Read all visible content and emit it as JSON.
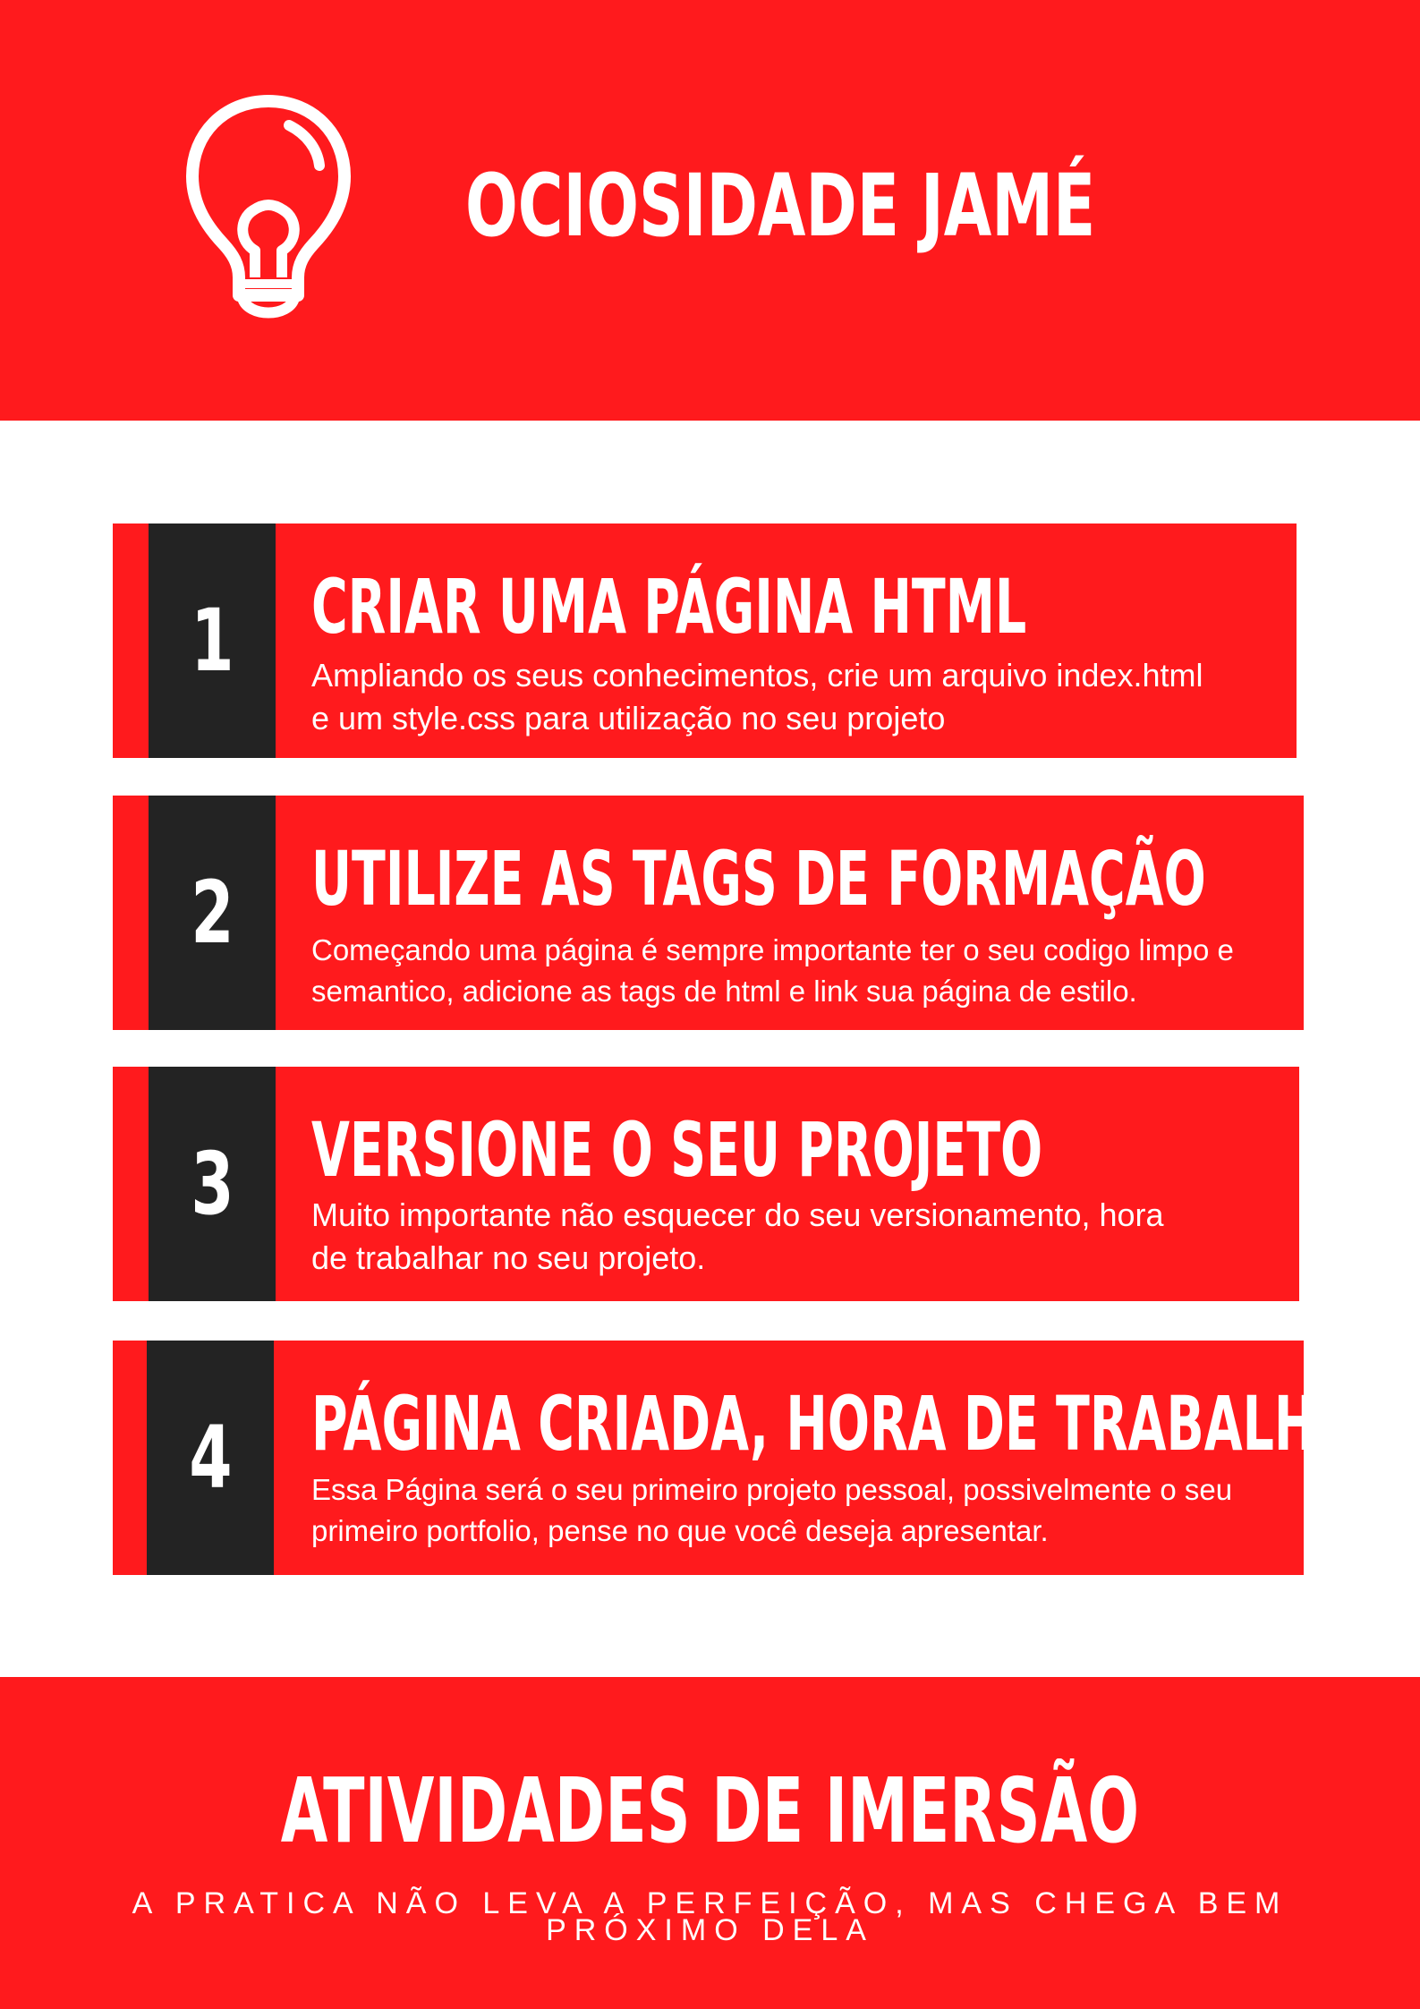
{
  "header": {
    "icon": "lightbulb-icon",
    "title": "OCIOSIDADE JAMÉ"
  },
  "steps": [
    {
      "number": "1",
      "title": "CRIAR UMA PÁGINA HTML",
      "description": "Ampliando os seus conhecimentos, crie um arquivo index.html e um style.css para utilização no seu projeto"
    },
    {
      "number": "2",
      "title": "UTILIZE AS TAGS DE FORMAÇÃO",
      "description": "Começando uma página é sempre importante ter o seu codigo limpo e semantico, adicione as tags de html e link sua página de estilo."
    },
    {
      "number": "3",
      "title": "VERSIONE O SEU PROJETO",
      "description": "Muito importante não esquecer do seu versionamento, hora de trabalhar no seu projeto."
    },
    {
      "number": "4",
      "title": "PÁGINA CRIADA, HORA DE TRABALHAR",
      "description": "Essa Página será o seu primeiro projeto pessoal, possivelmente o seu primeiro portfolio, pense no que você deseja apresentar."
    }
  ],
  "footer": {
    "title": "ATIVIDADES DE IMERSÃO",
    "subtitle": "A PRATICA NÃO LEVA A PERFEIÇÃO, MAS CHEGA BEM PRÓXIMO DELA"
  },
  "colors": {
    "accent": "#ff1a1d",
    "dark": "#232323",
    "text": "#ffffff"
  }
}
